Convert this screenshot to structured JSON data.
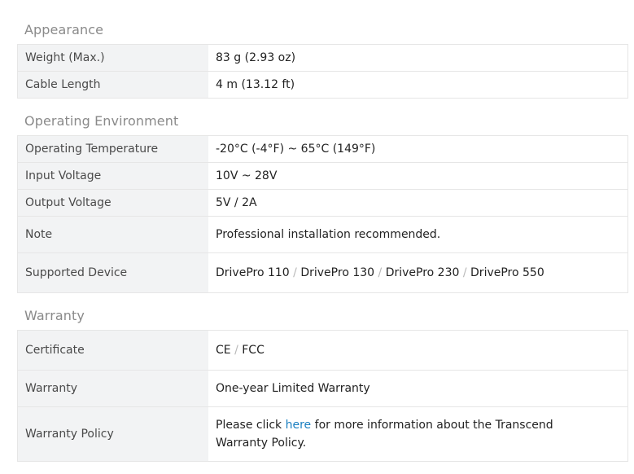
{
  "sections": [
    {
      "title": "Appearance",
      "rows": [
        {
          "label": "Weight (Max.)",
          "value": "83 g (2.93 oz)"
        },
        {
          "label": "Cable Length",
          "value": "4 m (13.12 ft)"
        }
      ]
    },
    {
      "title": "Operating Environment",
      "rows": [
        {
          "label": "Operating Temperature",
          "value": "-20°C (-4°F) ~ 65°C (149°F)"
        },
        {
          "label": "Input Voltage",
          "value": "10V ~ 28V"
        },
        {
          "label": "Output Voltage",
          "value": "5V / 2A"
        },
        {
          "label": "Note",
          "value": "Professional installation recommended."
        },
        {
          "label": "Supported Device",
          "values": [
            "DrivePro 110",
            "DrivePro 130",
            "DrivePro 230",
            "DrivePro 550"
          ],
          "separator": "/"
        }
      ]
    },
    {
      "title": "Warranty",
      "rows": [
        {
          "label": "Certificate",
          "values": [
            "CE",
            "FCC"
          ],
          "separator": "/"
        },
        {
          "label": "Warranty",
          "value": "One-year Limited Warranty"
        },
        {
          "label": "Warranty Policy",
          "prefix": "Please click ",
          "link": "here",
          "suffix": " for more information about the Transcend Warranty Policy."
        }
      ]
    }
  ]
}
